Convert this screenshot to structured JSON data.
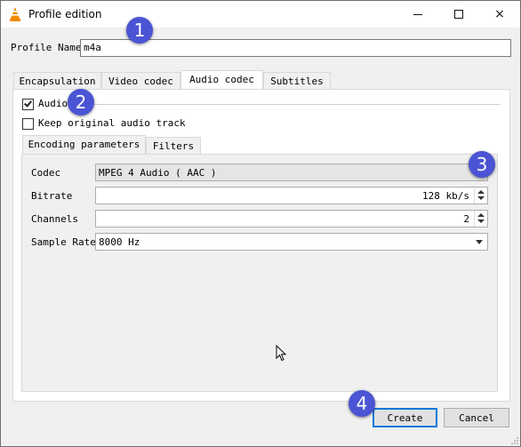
{
  "window": {
    "title": "Profile edition",
    "minimize": "minimize",
    "maximize": "maximize",
    "close": "×"
  },
  "profile": {
    "label": "Profile Name",
    "value": "m4a"
  },
  "main_tabs": [
    {
      "label": "Encapsulation",
      "active": false
    },
    {
      "label": "Video codec",
      "active": false
    },
    {
      "label": "Audio codec",
      "active": true
    },
    {
      "label": "Subtitles",
      "active": false
    }
  ],
  "audio": {
    "enable_label": "Audio",
    "enable_checked": true,
    "keep_label": "Keep original audio track",
    "keep_checked": false
  },
  "sub_tabs": [
    {
      "label": "Encoding parameters",
      "active": true
    },
    {
      "label": "Filters",
      "active": false
    }
  ],
  "params": {
    "codec_label": "Codec",
    "codec_value": "MPEG 4 Audio ( AAC )",
    "bitrate_label": "Bitrate",
    "bitrate_value": "128 kb/s",
    "channels_label": "Channels",
    "channels_value": "2",
    "sample_rate_label": "Sample Rate",
    "sample_rate_value": "8000 Hz"
  },
  "buttons": {
    "create": "Create",
    "cancel": "Cancel"
  },
  "annotations": [
    "1",
    "2",
    "3",
    "4"
  ],
  "colors": {
    "badge": "#4a54d4",
    "focus_border": "#0078d7",
    "vlc_orange": "#f08a00"
  },
  "icons": {
    "app": "vlc-cone-icon",
    "cursor": "mouse-pointer-icon"
  }
}
